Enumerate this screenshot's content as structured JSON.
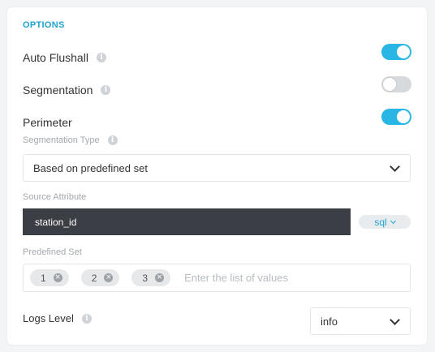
{
  "section": {
    "title": "OPTIONS"
  },
  "options": [
    {
      "label": "Auto Flushall",
      "has_info": true,
      "enabled": true
    },
    {
      "label": "Segmentation",
      "has_info": true,
      "enabled": false
    },
    {
      "label": "Perimeter",
      "has_info": false,
      "enabled": true
    }
  ],
  "segmentation_type": {
    "label": "Segmentation Type",
    "value": "Based on predefined set"
  },
  "source_attribute": {
    "label": "Source Attribute",
    "value": "station_id",
    "mode": "sql"
  },
  "predefined_set": {
    "label": "Predefined Set",
    "values": [
      "1",
      "2",
      "3"
    ],
    "placeholder": "Enter the list of values"
  },
  "logs_level": {
    "label": "Logs Level",
    "value": "info"
  },
  "colors": {
    "accent": "#29b6e5",
    "dark_field": "#3b3e44"
  },
  "icons": {
    "info": "info-icon",
    "chevron": "chevron-down-icon",
    "remove": "remove-tag-icon"
  }
}
